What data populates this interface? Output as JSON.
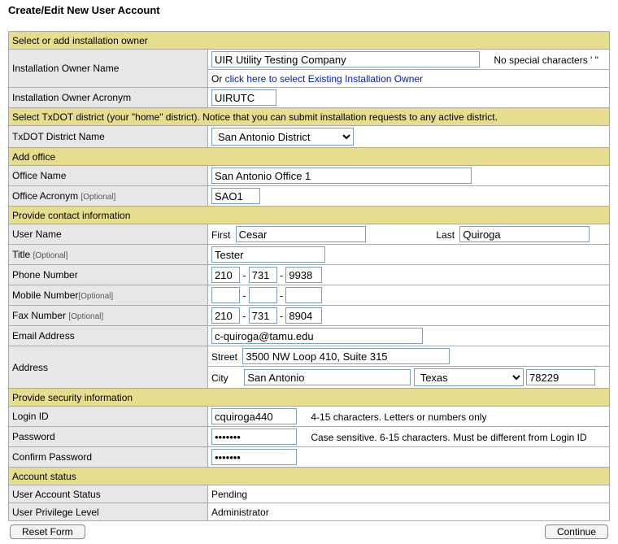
{
  "page_title": "Create/Edit New User Account",
  "sections": {
    "owner_header": "Select or add installation owner",
    "district_header": "Select TxDOT district (your \"home\" district). Notice that you can submit installation requests to any active district.",
    "office_header": "Add office",
    "contact_header": "Provide contact information",
    "security_header": "Provide security information",
    "status_header": "Account status"
  },
  "labels": {
    "owner_name": "Installation Owner Name",
    "owner_acronym": "Installation Owner Acronym",
    "district_name": "TxDOT District Name",
    "office_name": "Office Name",
    "office_acronym": "Office Acronym",
    "user_name": "User Name",
    "title": "Title",
    "phone": "Phone Number",
    "mobile": "Mobile Number",
    "fax": "Fax Number",
    "email": "Email Address",
    "address": "Address",
    "login_id": "Login ID",
    "password": "Password",
    "confirm_password": "Confirm Password",
    "account_status": "User Account Status",
    "privilege": "User Privilege Level",
    "optional": "[Optional]",
    "first": "First",
    "last": "Last",
    "street": "Street",
    "city": "City"
  },
  "hints": {
    "no_special": "No special characters ' \"",
    "or": "Or ",
    "existing_link": "click here to select Existing Installation Owner",
    "login_rule": "4-15 characters. Letters or numbers only",
    "password_rule": "Case sensitive. 6-15 characters. Must be different from Login ID"
  },
  "values": {
    "owner_name": "UIR Utility Testing Company",
    "owner_acronym": "UIRUTC",
    "district": "San Antonio District",
    "office_name": "San Antonio Office 1",
    "office_acronym": "SAO1",
    "first_name": "Cesar",
    "last_name": "Quiroga",
    "title": "Tester",
    "phone1": "210",
    "phone2": "731",
    "phone3": "9938",
    "mobile1": "",
    "mobile2": "",
    "mobile3": "",
    "fax1": "210",
    "fax2": "731",
    "fax3": "8904",
    "email": "c-quiroga@tamu.edu",
    "street": "3500 NW Loop 410, Suite 315",
    "city": "San Antonio",
    "state": "Texas",
    "zip": "78229",
    "login_id": "cquiroga440",
    "password": "•••••••",
    "confirm_password": "•••••••",
    "account_status": "Pending",
    "privilege": "Administrator"
  },
  "buttons": {
    "reset": "Reset Form",
    "continue": "Continue"
  }
}
